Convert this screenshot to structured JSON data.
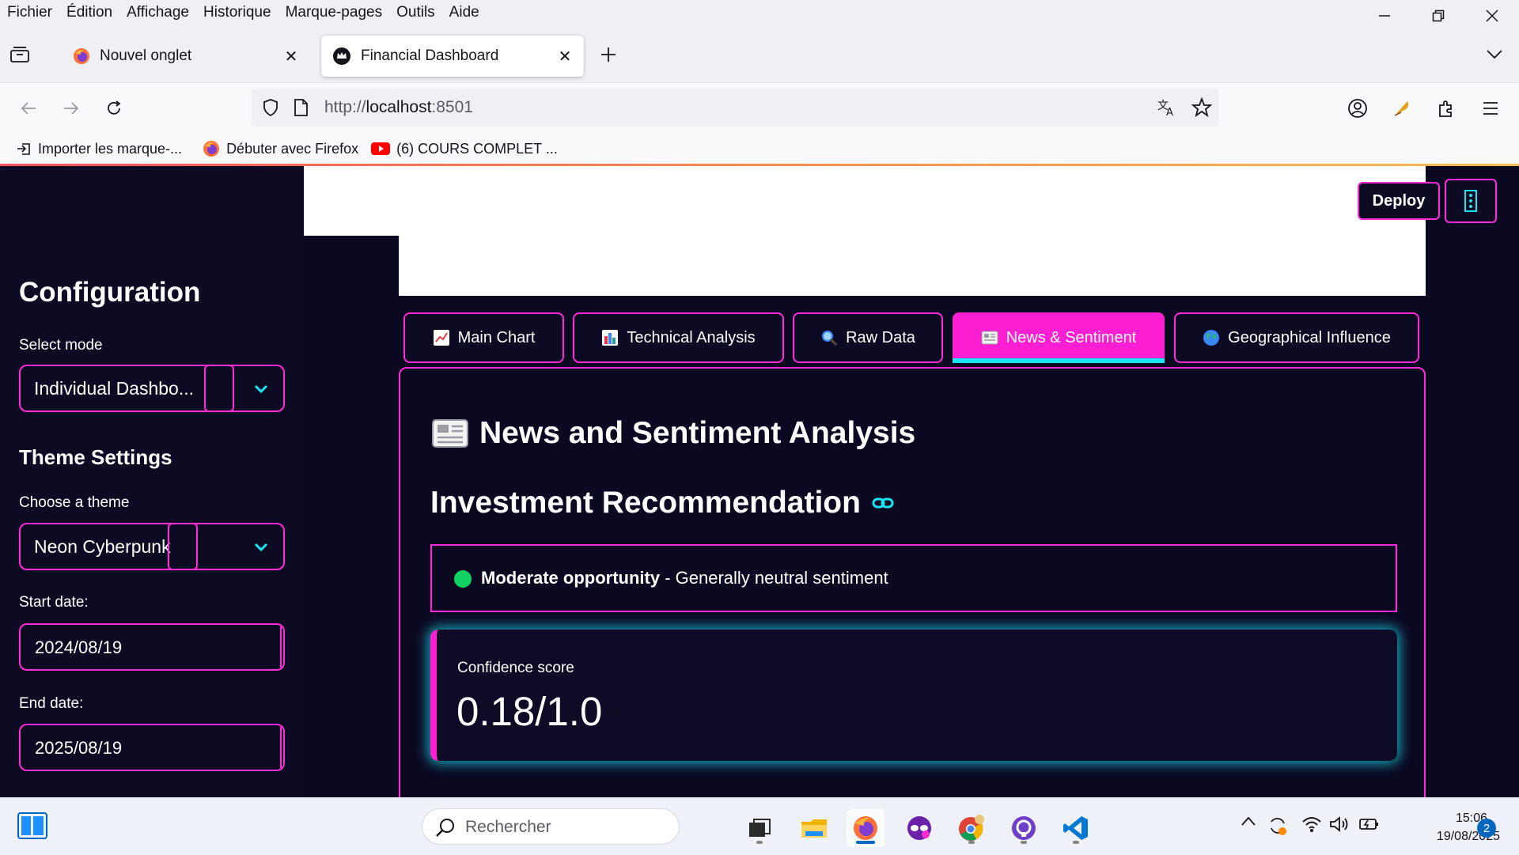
{
  "menubar": {
    "items": [
      "Fichier",
      "Édition",
      "Affichage",
      "Historique",
      "Marque-pages",
      "Outils",
      "Aide"
    ]
  },
  "browser": {
    "tabs": [
      {
        "title": "Nouvel onglet",
        "icon": "firefox-icon"
      },
      {
        "title": "Financial Dashboard",
        "icon": "streamlit-crown-icon"
      }
    ],
    "url_prefix": "http://",
    "url_host": "localhost",
    "url_suffix": ":8501",
    "bookmarks": [
      "Importer les marque-...",
      "Débuter avec Firefox",
      "(6) COURS COMPLET ..."
    ]
  },
  "header": {
    "deploy_label": "Deploy"
  },
  "sidebar": {
    "title": "Configuration",
    "mode_label": "Select mode",
    "mode_value": "Individual Dashbo...",
    "theme_title": "Theme Settings",
    "theme_label": "Choose a theme",
    "theme_value": "Neon Cyberpunk",
    "start_label": "Start date:",
    "start_value": "2024/08/19",
    "end_label": "End date:",
    "end_value": "2025/08/19"
  },
  "tabs": [
    {
      "label": "Main Chart",
      "icon": "chart-increasing-icon",
      "active": false
    },
    {
      "label": "Technical Analysis",
      "icon": "bar-chart-icon",
      "active": false
    },
    {
      "label": "Raw Data",
      "icon": "magnifier-icon",
      "active": false
    },
    {
      "label": "News & Sentiment",
      "icon": "newspaper-icon",
      "active": true
    },
    {
      "label": "Geographical Influence",
      "icon": "globe-icon",
      "active": false
    }
  ],
  "content": {
    "section_title": "News and Sentiment Analysis",
    "recommendation_title": "Investment Recommendation",
    "recommendation_strong": "Moderate opportunity",
    "recommendation_rest": " - Generally neutral sentiment",
    "metric_label": "Confidence score",
    "metric_value": "0.18/1.0"
  },
  "taskbar": {
    "search_placeholder": "Rechercher",
    "time": "15:06",
    "date": "19/08/2025",
    "notifications": "2"
  },
  "colors": {
    "accent_pink": "#ff1fd2",
    "accent_cyan": "#19e5f5",
    "bg": "#0b0821",
    "positive": "#10d263"
  }
}
